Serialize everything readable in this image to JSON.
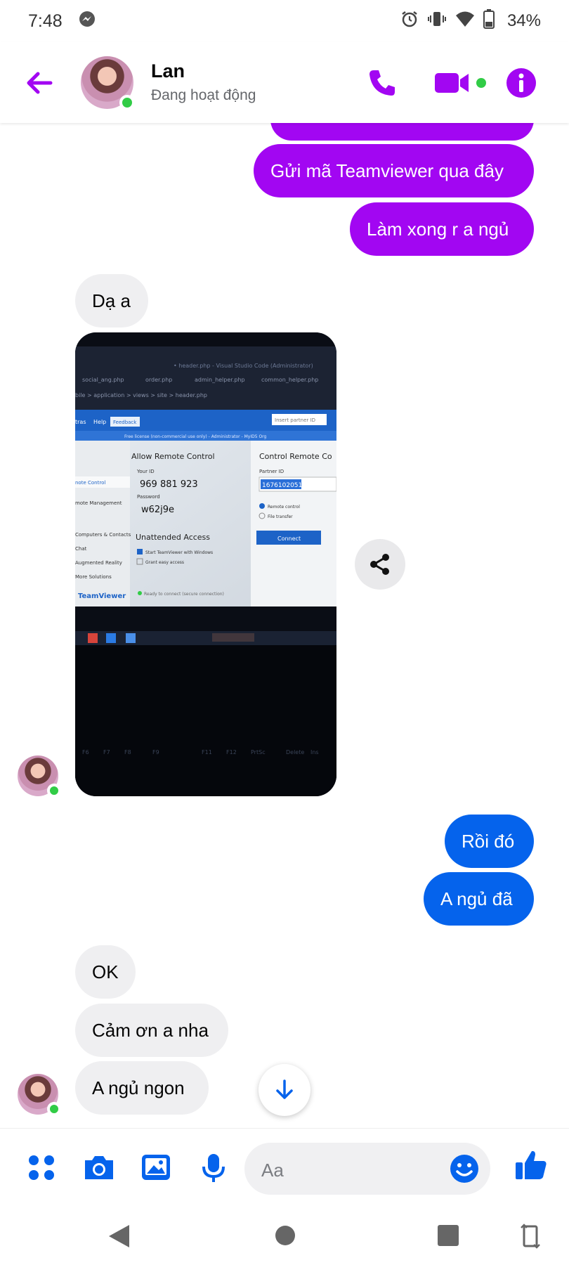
{
  "status_bar": {
    "time": "7:48",
    "battery": "34%"
  },
  "header": {
    "name": "Lan",
    "status": "Đang hoạt động"
  },
  "messages": {
    "out1": "Gửi mã Teamviewer qua đây",
    "out2": "Làm xong r a ngủ",
    "in1": "Dạ a",
    "out3": "Rồi đó",
    "out4": "A ngủ đã",
    "in2": "OK",
    "in3": "Cảm ơn a nha",
    "in4": "A ngủ ngon"
  },
  "photo": {
    "panel_left_title": "Allow Remote Control",
    "your_id_label": "Your ID",
    "your_id": "969 881 923",
    "password_label": "Password",
    "password": "w62j9e",
    "unattended_title": "Unattended Access",
    "start_windows": "Start TeamViewer with Windows",
    "grant_access": "Grant easy access",
    "panel_right_title": "Control Remote Co",
    "partner_label": "Partner ID",
    "partner_id": "1676102051",
    "remote_control": "Remote control",
    "file_transfer": "File transfer",
    "connect": "Connect",
    "brand": "TeamViewer",
    "menu_help": "Help",
    "menu_feedback": "Feedback",
    "menu_extras": "tras",
    "nav_remote_control": "note Control",
    "nav_remote_mgmt": "mote Management",
    "nav_computers": "Computers & Contacts",
    "nav_chat": "Chat",
    "nav_ar": "Augmented Reality",
    "nav_more": "More Solutions",
    "ready": "Ready to connect (secure connection)",
    "insert_partner": "Insert partner ID",
    "tab1": "social_ang.php",
    "tab2": "order.php",
    "tab3": "admin_helper.php",
    "tab4": "common_helper.php",
    "breadcrumb": "bile > application > views > site > header.php",
    "free_license": "Free license (non-commercial use only) - Administrator - MyID5 Org"
  },
  "composer": {
    "placeholder": "Aa"
  },
  "colors": {
    "accent": "#a206f2",
    "blue": "#0563ec",
    "online": "#31cc46",
    "incoming": "#efeff1"
  }
}
